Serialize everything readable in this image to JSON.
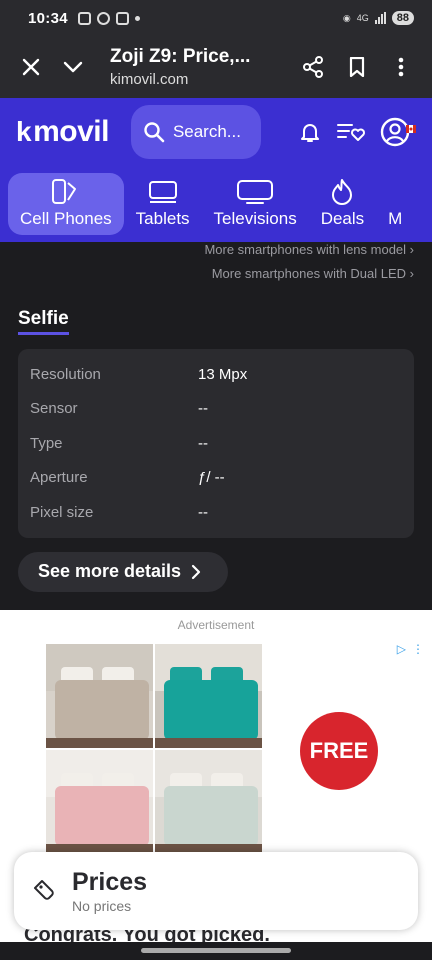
{
  "status_bar": {
    "time": "10:34",
    "network": "4G",
    "battery": "88"
  },
  "browser": {
    "title": "Zoji Z9: Price,...",
    "url": "kimovil.com",
    "close_icon": "close-icon",
    "collapse_icon": "chevron-down-icon",
    "share_icon": "share-icon",
    "bookmark_icon": "bookmark-icon",
    "menu_icon": "more-vert-icon"
  },
  "site": {
    "logo_text": "movil",
    "logo_mark": "k",
    "search_label": "Search...",
    "colors": {
      "brand": "#3b2fd1",
      "search_pill": "#5c52e3",
      "active_tab": "#6a62ea"
    }
  },
  "categories": [
    {
      "label": "Cell Phones",
      "icon": "phone-icon",
      "active": true
    },
    {
      "label": "Tablets",
      "icon": "tablet-icon",
      "active": false
    },
    {
      "label": "Televisions",
      "icon": "tv-icon",
      "active": false
    },
    {
      "label": "Deals",
      "icon": "flame-icon",
      "active": false
    },
    {
      "label": "M",
      "icon": "",
      "active": false
    }
  ],
  "links": {
    "lens_model": "More smartphones with lens model",
    "dual_led": "More smartphones with Dual LED"
  },
  "selfie": {
    "title": "Selfie",
    "rows": [
      {
        "label": "Resolution",
        "value": "13 Mpx"
      },
      {
        "label": "Sensor",
        "value": "--"
      },
      {
        "label": "Type",
        "value": "--"
      },
      {
        "label": "Aperture",
        "value": "ƒ/ --"
      },
      {
        "label": "Pixel size",
        "value": "--"
      }
    ],
    "details_button": "See more details"
  },
  "ad": {
    "label": "Advertisement",
    "badge": "FREE",
    "bottom_text": "Congrats. You got picked."
  },
  "prices": {
    "title": "Prices",
    "subtitle": "No prices"
  }
}
